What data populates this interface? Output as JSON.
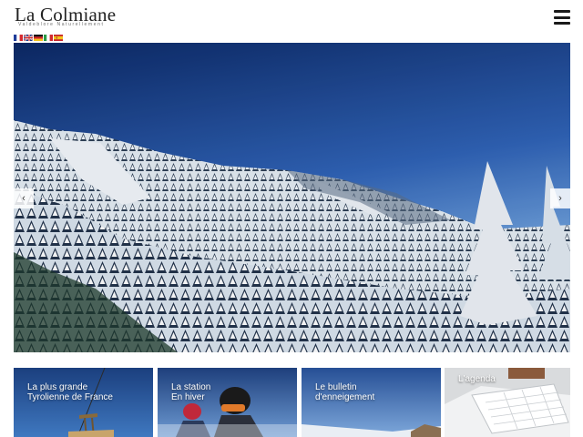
{
  "header": {
    "site_title": "La Colmiane",
    "tagline": "Valdeblore Naturellement",
    "languages": [
      {
        "code": "fr",
        "icon": "france-flag-icon"
      },
      {
        "code": "en",
        "icon": "uk-flag-icon"
      },
      {
        "code": "de",
        "icon": "germany-flag-icon"
      },
      {
        "code": "it",
        "icon": "italy-flag-icon"
      },
      {
        "code": "es",
        "icon": "spain-flag-icon"
      }
    ],
    "menu_icon": "hamburger-menu-icon"
  },
  "slider": {
    "image": "snowy-forest-mountain-photo",
    "prev_label": "‹",
    "next_label": "›"
  },
  "cards": [
    {
      "label": "La plus grande\nTyrolienne de France",
      "image": "zipline-tower-photo"
    },
    {
      "label": "La station\nEn hiver",
      "image": "skier-helmet-photo"
    },
    {
      "label": "Le bulletin\nd'enneigement",
      "image": "snowy-slope-photo"
    },
    {
      "label": "L'agenda",
      "image": "calendar-notebook-photo"
    }
  ],
  "colors": {
    "sky_top": "#0d2a6b",
    "sky_bottom": "#4f8fd8",
    "text_dark": "#222222"
  }
}
